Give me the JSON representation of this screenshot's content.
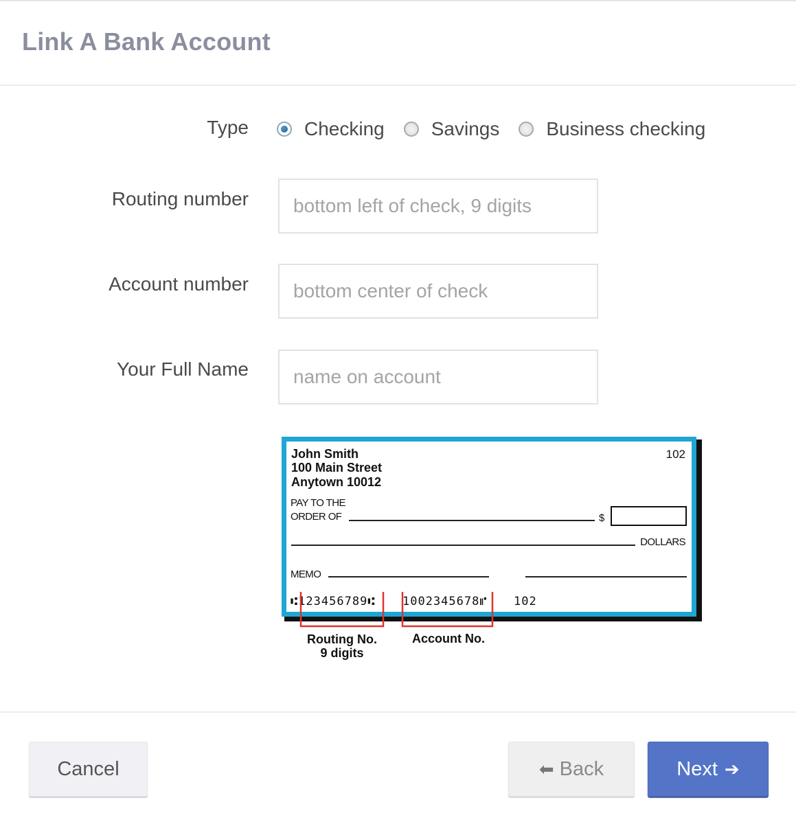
{
  "dialog": {
    "title": "Link A Bank Account"
  },
  "form": {
    "type": {
      "label": "Type",
      "options": [
        {
          "label": "Checking",
          "selected": true
        },
        {
          "label": "Savings",
          "selected": false
        },
        {
          "label": "Business checking",
          "selected": false
        }
      ]
    },
    "routing": {
      "label": "Routing number",
      "value": "",
      "placeholder": "bottom left of check, 9 digits"
    },
    "account": {
      "label": "Account number",
      "value": "",
      "placeholder": "bottom center of check"
    },
    "fullname": {
      "label": "Your Full Name",
      "value": "",
      "placeholder": "name on account"
    }
  },
  "check_image": {
    "name": "John Smith",
    "street": "100 Main Street",
    "city": "Anytown  10012",
    "check_number": "102",
    "pay_to_line1": "PAY TO THE",
    "pay_to_line2": "ORDER OF",
    "dollar_sign": "$",
    "dollars": "DOLLARS",
    "memo": "MEMO",
    "micr_routing": "⑆123456789⑆",
    "micr_account": "1002345678⑈",
    "micr_check": "102",
    "routing_caption_1": "Routing No.",
    "routing_caption_2": "9 digits",
    "account_caption": "Account No.",
    "border_color": "#1fa6d4",
    "bracket_color": "#e0332e"
  },
  "footer": {
    "cancel_label": "Cancel",
    "back_label": "Back",
    "next_label": "Next",
    "back_icon": "arrow-left-icon",
    "next_icon": "arrow-right-icon",
    "next_color": "#5374c7"
  }
}
